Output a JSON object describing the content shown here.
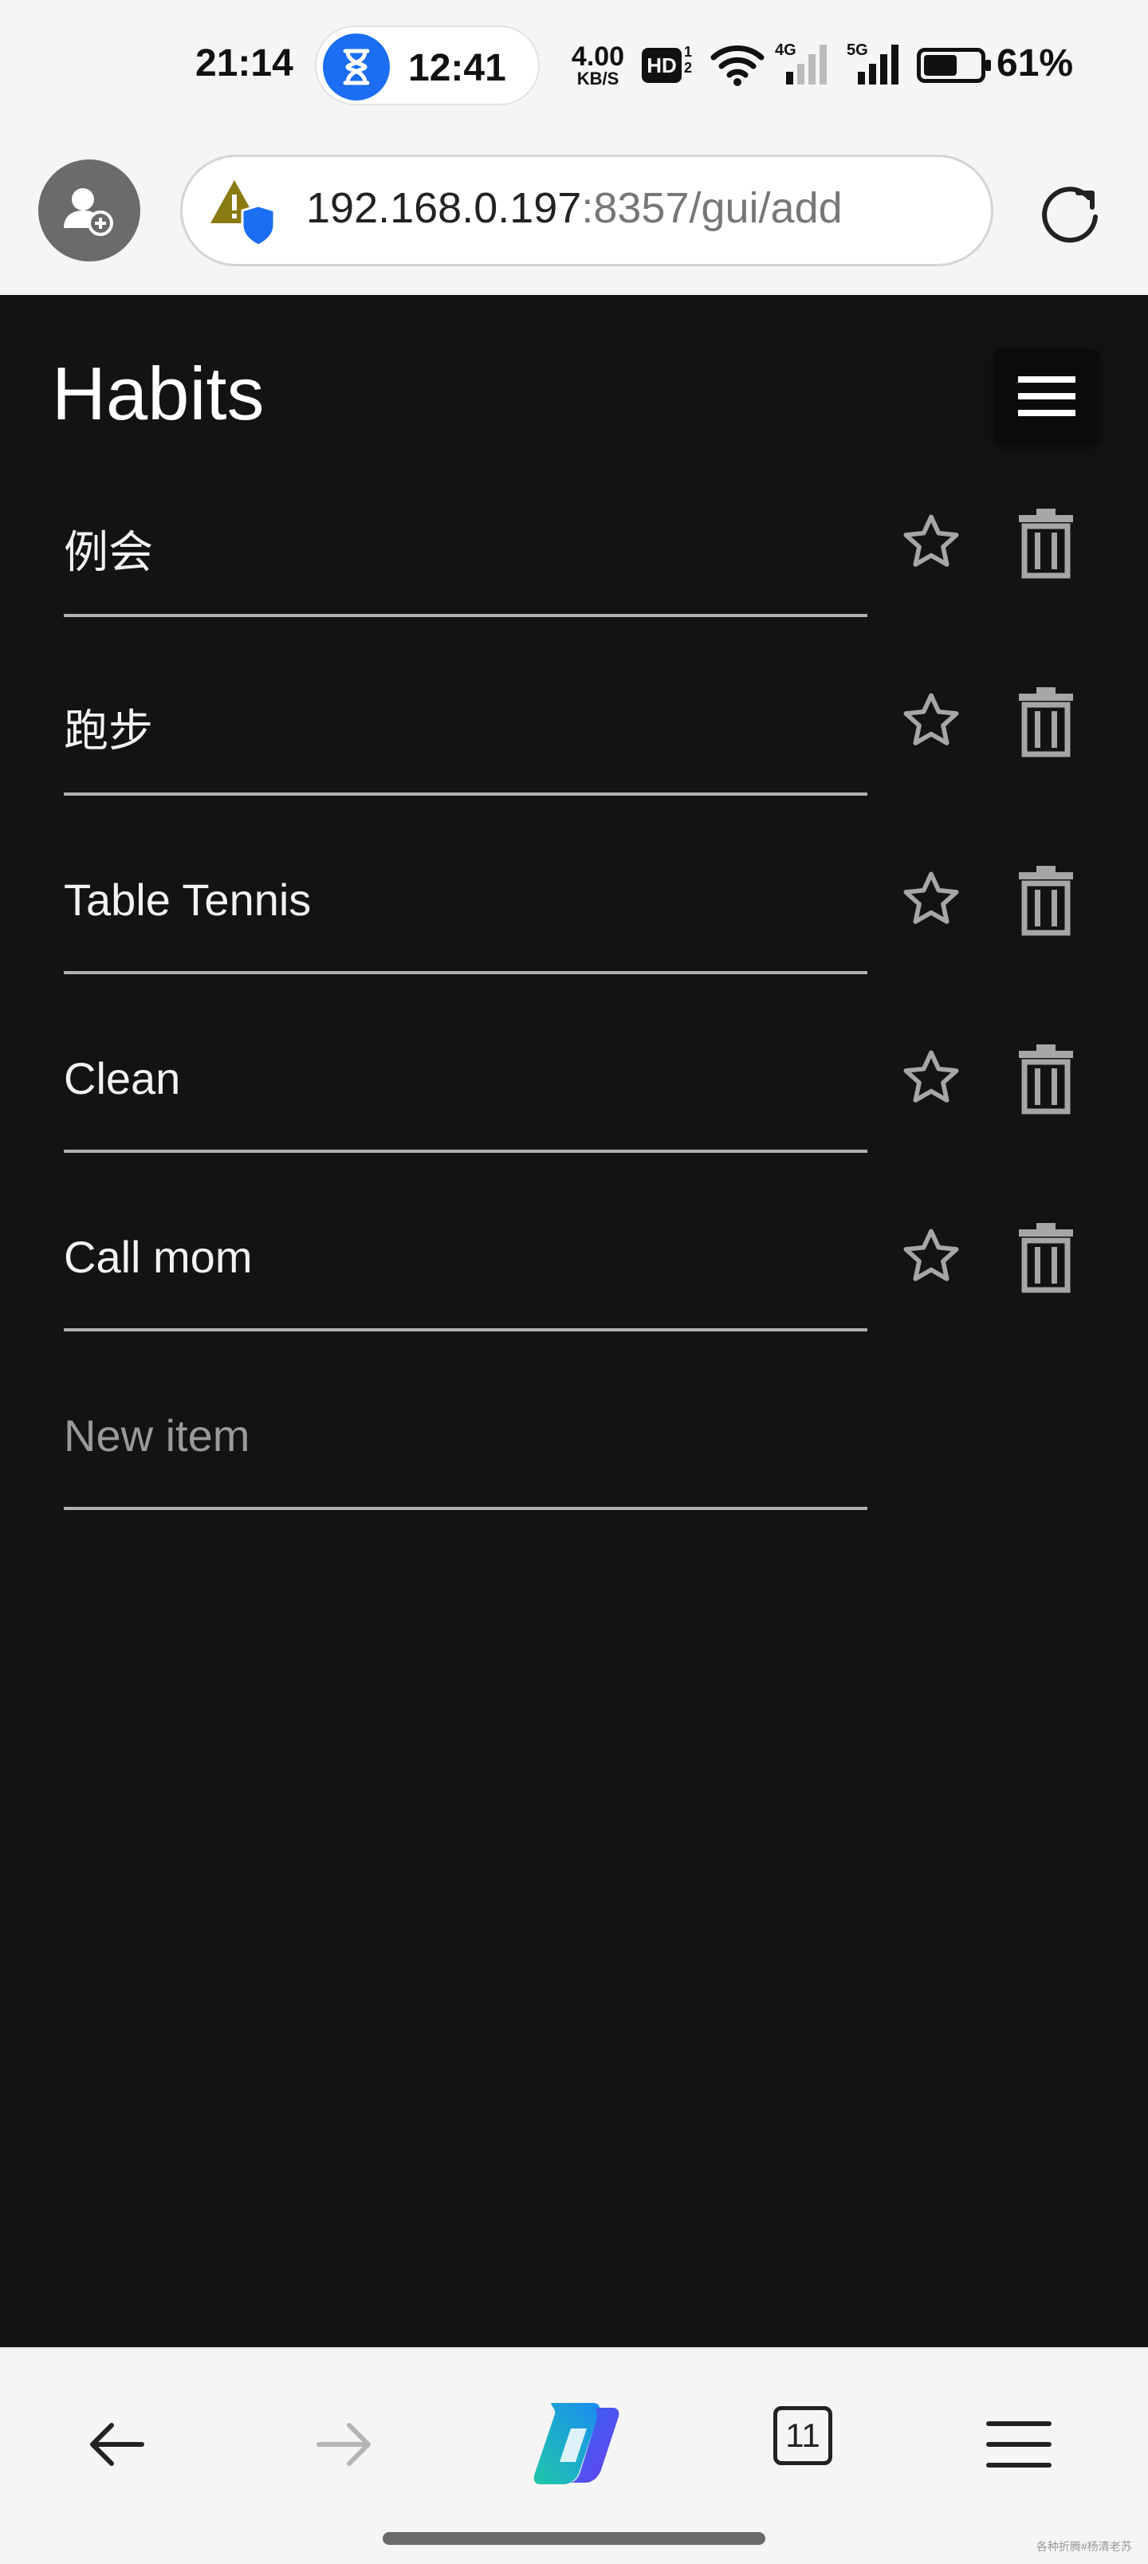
{
  "status_bar": {
    "time": "21:14",
    "timer": "12:41",
    "net_speed_value": "4.00",
    "net_speed_unit": "KB/S",
    "hd_label": "HD",
    "hd_sub_top": "1",
    "hd_sub_bottom": "2",
    "sim1_label": "4G",
    "sim2_label": "5G",
    "battery_text": "61%",
    "battery_level": 0.61
  },
  "browser": {
    "url_host": "192.168.0.197",
    "url_path": ":8357/gui/add"
  },
  "app": {
    "title": "Habits",
    "habits": [
      {
        "label": "例会"
      },
      {
        "label": "跑步"
      },
      {
        "label": "Table Tennis"
      },
      {
        "label": "Clean"
      },
      {
        "label": "Call mom"
      }
    ],
    "new_item_placeholder": "New item"
  },
  "toolbar": {
    "tab_count": "11"
  },
  "watermark": "各种折腾#杨清老苏",
  "colors": {
    "app_background": "#131313",
    "accent_blue": "#1b6ef3"
  }
}
